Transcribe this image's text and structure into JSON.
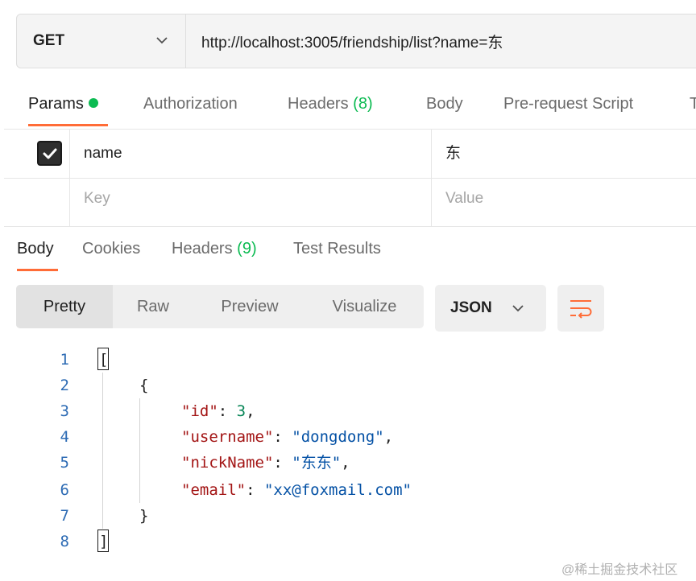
{
  "request": {
    "method": "GET",
    "url": "http://localhost:3005/friendship/list?name=东"
  },
  "request_tabs": [
    {
      "label": "Params",
      "active": true,
      "has_dot": true
    },
    {
      "label": "Authorization"
    },
    {
      "label": "Headers",
      "count": "(8)"
    },
    {
      "label": "Body"
    },
    {
      "label": "Pre-request Script"
    },
    {
      "label": "T"
    }
  ],
  "params": {
    "rows": [
      {
        "checked": true,
        "key": "name",
        "value": "东"
      }
    ],
    "new_row": {
      "key_placeholder": "Key",
      "value_placeholder": "Value"
    }
  },
  "response_tabs": [
    {
      "label": "Body",
      "active": true
    },
    {
      "label": "Cookies"
    },
    {
      "label": "Headers",
      "count": "(9)"
    },
    {
      "label": "Test Results"
    }
  ],
  "view_modes": [
    "Pretty",
    "Raw",
    "Preview",
    "Visualize"
  ],
  "active_view": "Pretty",
  "format": "JSON",
  "code": {
    "line_numbers": [
      "1",
      "2",
      "3",
      "4",
      "5",
      "6",
      "7",
      "8"
    ],
    "open_bracket": "[",
    "open_brace": "{",
    "fields": [
      {
        "key": "\"id\"",
        "colon": ": ",
        "value": "3",
        "type": "number",
        "comma": ","
      },
      {
        "key": "\"username\"",
        "colon": ": ",
        "value": "\"dongdong\"",
        "type": "string",
        "comma": ","
      },
      {
        "key": "\"nickName\"",
        "colon": ": ",
        "value": "\"东东\"",
        "type": "string",
        "comma": ","
      },
      {
        "key": "\"email\"",
        "colon": ": ",
        "value": "\"xx@foxmail.com\"",
        "type": "string",
        "comma": ""
      }
    ],
    "close_brace": "}",
    "close_bracket": "]"
  },
  "watermark": "@稀土掘金技术社区",
  "colors": {
    "accent": "#ff6c37",
    "success": "#0cbb52"
  }
}
